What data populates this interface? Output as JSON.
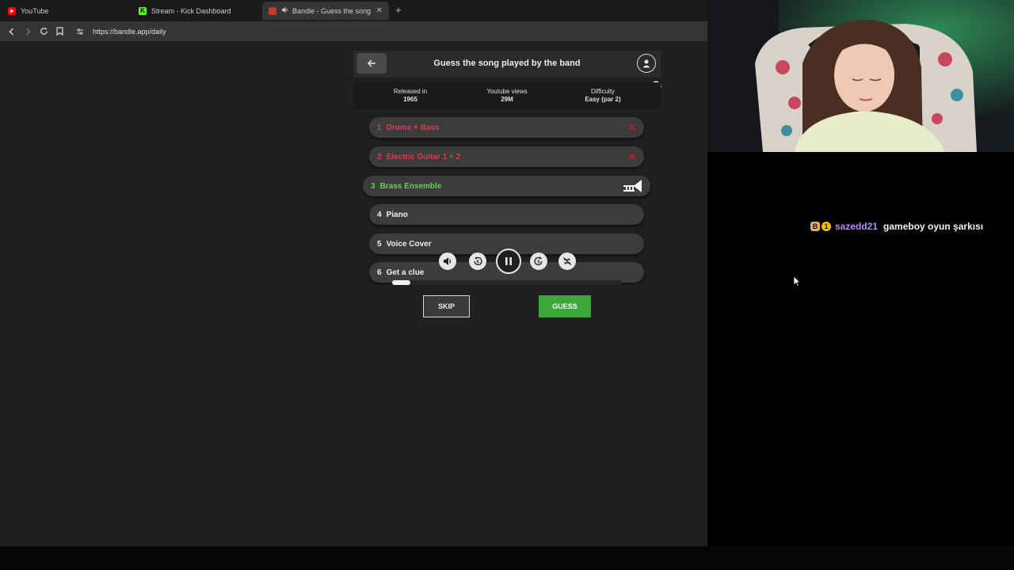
{
  "browser": {
    "tabs": [
      {
        "label": "YouTube",
        "favicon_color": "#ff0000"
      },
      {
        "label": "Stream - Kick Dashboard",
        "favicon_color": "#53fc18"
      },
      {
        "label": "Bandle - Guess the song, one",
        "favicon_color": "#c0392b",
        "close": "✕"
      }
    ],
    "new_tab_label": "+",
    "url": "https://bandle.app/daily"
  },
  "app": {
    "title": "Guess the song played by the band",
    "info": [
      {
        "label": "Released in",
        "value": "1965"
      },
      {
        "label": "Youtube views",
        "value": "29M"
      },
      {
        "label": "Difficulty",
        "value": "Easy (par 2)"
      }
    ],
    "tracks": [
      {
        "num": "1",
        "label": "Drums + Bass",
        "state": "failed"
      },
      {
        "num": "2",
        "label": "Electric Guitar 1 + 2",
        "state": "failed"
      },
      {
        "num": "3",
        "label": "Brass Ensemble",
        "state": "active",
        "icon": "trumpet-icon"
      },
      {
        "num": "4",
        "label": "Piano",
        "state": "locked"
      },
      {
        "num": "5",
        "label": "Voice Cover",
        "state": "locked"
      },
      {
        "num": "6",
        "label": "Get a clue",
        "state": "locked"
      }
    ],
    "controls": [
      "volume-icon",
      "rewind-5-icon",
      "pause-icon",
      "forward-5-icon",
      "no-repeat-icon"
    ],
    "progress_fraction": 0.08,
    "skip_label": "SKIP",
    "guess_label": "GUESS",
    "colors": {
      "failed": "#e0394a",
      "active": "#5fd34a",
      "guess": "#3ca83a"
    }
  },
  "chat": {
    "badges": [
      "B",
      "1"
    ],
    "username": "sazedd21",
    "message": "gameboy oyun şarkısı"
  }
}
